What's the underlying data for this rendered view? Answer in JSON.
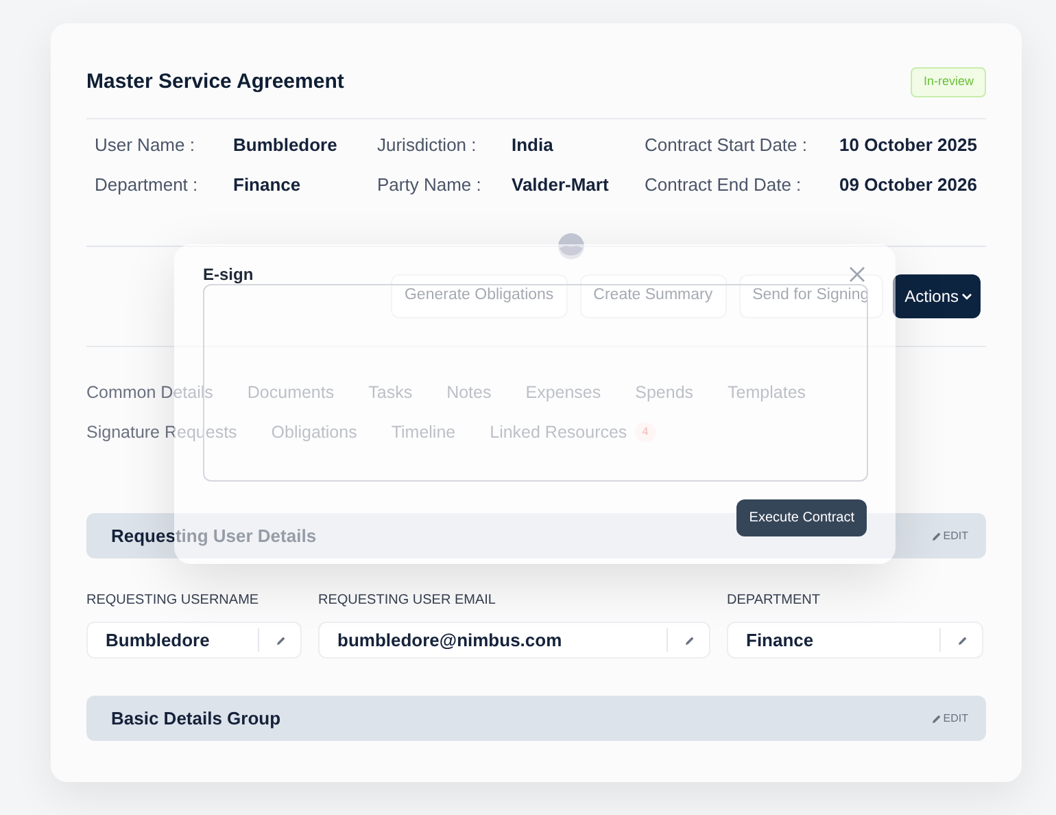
{
  "header": {
    "title": "Master Service Agreement",
    "status": "In-review"
  },
  "details": [
    {
      "label": "User Name :",
      "value": "Bumbledore"
    },
    {
      "label": "Jurisdiction :",
      "value": "India"
    },
    {
      "label": "Contract Start Date :",
      "value": "10 October 2025"
    },
    {
      "label": "Department :",
      "value": "Finance"
    },
    {
      "label": "Party Name :",
      "value": "Valder-Mart"
    },
    {
      "label": "Contract End Date :",
      "value": "09 October 2026"
    }
  ],
  "actions": [
    "Generate Obligations",
    "Create Summary",
    "Send for Signing"
  ],
  "actions_menu": "Actions",
  "tab_rows": [
    [
      {
        "label": "Common Details"
      },
      {
        "label": "Documents"
      },
      {
        "label": "Tasks"
      },
      {
        "label": "Notes"
      },
      {
        "label": "Expenses"
      },
      {
        "label": "Spends"
      },
      {
        "label": "Templates"
      }
    ],
    [
      {
        "label": "Signature Requests"
      },
      {
        "label": "Obligations"
      },
      {
        "label": "Timeline"
      },
      {
        "label": "Linked Resources",
        "count": "4"
      }
    ]
  ],
  "sections": [
    {
      "title": "Requesting User Details",
      "edit": "EDIT",
      "fields": [
        {
          "label": "REQUESTING USERNAME",
          "value": "Bumbledore"
        },
        {
          "label": "REQUESTING USER EMAIL",
          "value": "bumbledore@nimbus.com"
        },
        {
          "label": "DEPARTMENT",
          "value": "Finance"
        }
      ]
    },
    {
      "title": "Basic Details Group",
      "edit": "EDIT"
    }
  ],
  "modal": {
    "title": "E-sign",
    "button": "Execute Contract"
  }
}
